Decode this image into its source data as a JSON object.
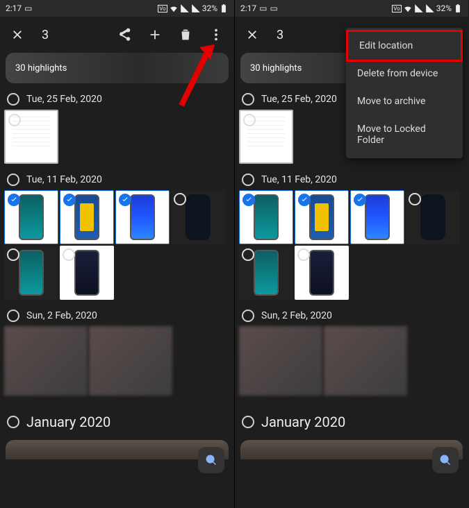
{
  "status": {
    "time": "2:17",
    "battery": "32%"
  },
  "toolbar": {
    "count": "3"
  },
  "highlights": {
    "label": "30 highlights"
  },
  "dates": {
    "d1": "Tue, 25 Feb, 2020",
    "d2": "Tue, 11 Feb, 2020",
    "d3": "Sun, 2 Feb, 2020"
  },
  "month": "January 2020",
  "menu": {
    "edit_location": "Edit location",
    "delete_device": "Delete from device",
    "move_archive": "Move to archive",
    "move_locked": "Move to Locked Folder"
  }
}
